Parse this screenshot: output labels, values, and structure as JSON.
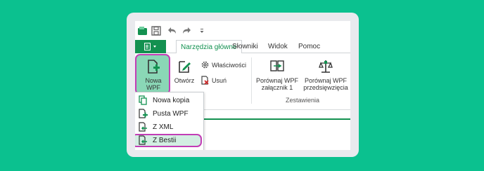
{
  "colors": {
    "background": "#0bc18f",
    "brand_green": "#139150",
    "highlight": "#c23db6"
  },
  "quick_access": [
    {
      "icon": "app-logo-icon"
    },
    {
      "icon": "save-icon"
    },
    {
      "icon": "undo-icon"
    },
    {
      "icon": "redo-icon"
    },
    {
      "icon": "customize-toolbar-icon"
    }
  ],
  "tabs": {
    "file_icon": "file-menu-icon",
    "items": [
      "Narzędzia główne",
      "Słowniki",
      "Widok",
      "Pomoc"
    ],
    "active": "Narzędzia główne"
  },
  "ribbon": {
    "new_wpf": {
      "label": "Nowa WPF",
      "icon": "new-document-icon"
    },
    "open": {
      "label": "Otwórz",
      "icon": "edit-icon"
    },
    "properties": {
      "label": "Właściwości",
      "icon": "gear-icon"
    },
    "delete": {
      "label": "Usuń",
      "icon": "delete-document-icon"
    },
    "compare_attachment": {
      "label_1": "Porównaj WPF",
      "label_2": "załącznik 1",
      "icon": "compare-icon"
    },
    "compare_project": {
      "label_1": "Porównaj WPF",
      "label_2": "przedsięwzięcia",
      "icon": "compare-project-icon"
    },
    "group_compare": "Zestawienia"
  },
  "dropdown": {
    "items": [
      {
        "label": "Nowa kopia",
        "icon": "copy-icon"
      },
      {
        "label": "Pusta WPF",
        "icon": "new-empty-icon"
      },
      {
        "label": "Z XML",
        "icon": "import-xml-icon"
      },
      {
        "label": "Z Bestii",
        "icon": "import-bestia-icon"
      }
    ],
    "selected": "Z Bestii"
  }
}
